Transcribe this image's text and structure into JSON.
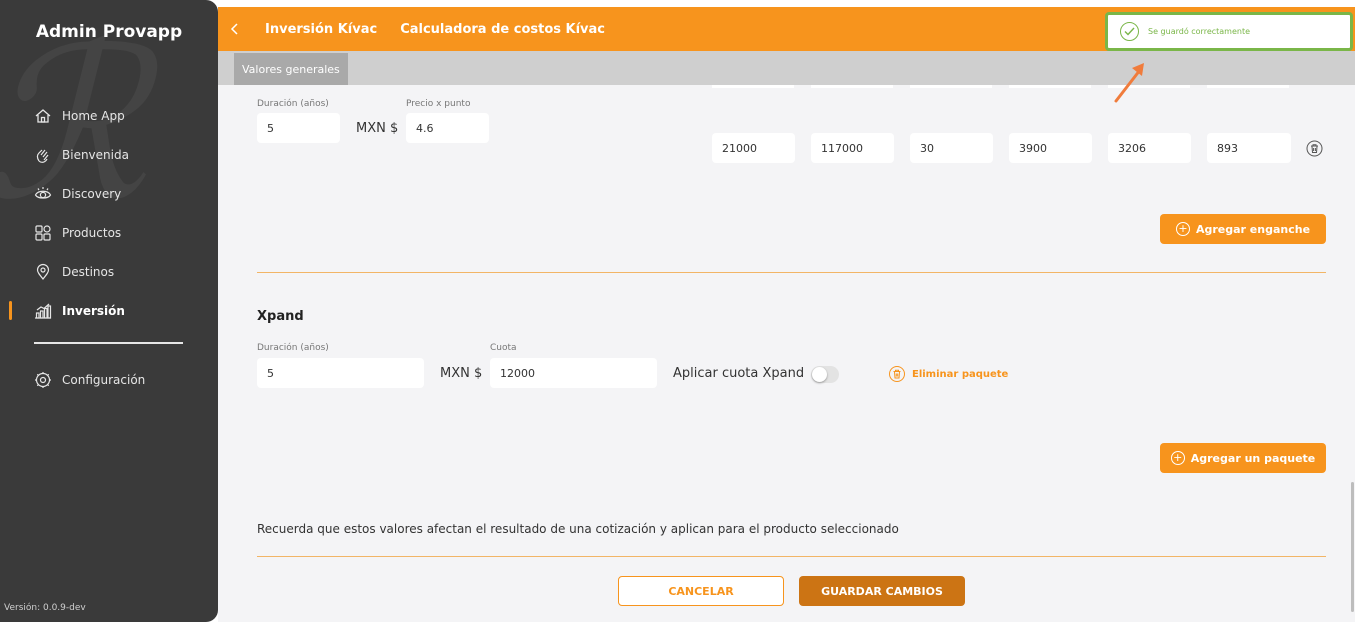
{
  "sidebar": {
    "brand": "Admin Provapp",
    "items": [
      {
        "label": "Home App",
        "icon": "home-icon"
      },
      {
        "label": "Bienvenida",
        "icon": "hand-wave-icon"
      },
      {
        "label": "Discovery",
        "icon": "eye-icon"
      },
      {
        "label": "Productos",
        "icon": "grid-icon"
      },
      {
        "label": "Destinos",
        "icon": "location-pin-icon"
      },
      {
        "label": "Inversión",
        "icon": "bar-chart-icon",
        "active": true
      }
    ],
    "settings": {
      "label": "Configuración",
      "icon": "gear-icon"
    },
    "version": "Versión: 0.0.9-dev"
  },
  "header": {
    "crumb_1": "Inversión Kívac",
    "crumb_2": "Calculadora de costos Kívac",
    "tab": "Valores generales"
  },
  "first_package": {
    "duration_label": "Duración (años)",
    "duration_value": "5",
    "currency": "MXN $",
    "price_label": "Precio x punto",
    "price_value": "4.6",
    "down_payment_row": [
      "21000",
      "117000",
      "30",
      "3900",
      "3206",
      "893"
    ],
    "add_down_payment_button": "Agregar enganche"
  },
  "xpand": {
    "title": "Xpand",
    "duration_label": "Duración (años)",
    "duration_value": "5",
    "currency": "MXN $",
    "fee_label": "Cuota",
    "fee_value": "12000",
    "apply_fee_label": "Aplicar cuota Xpand",
    "apply_fee_enabled": false,
    "delete_package": "Eliminar paquete"
  },
  "add_package_button": "Agregar un paquete",
  "note": "Recuerda que estos valores afectan el resultado de una cotización y aplican para el producto seleccionado",
  "footer": {
    "cancel": "CANCELAR",
    "save": "GUARDAR CAMBIOS"
  },
  "toast": {
    "message": "Se guardó correctamente"
  },
  "colors": {
    "accent": "#f7941d",
    "sidebar": "#3a3a3a",
    "success": "#7ab648",
    "save_button": "#cc7414"
  }
}
